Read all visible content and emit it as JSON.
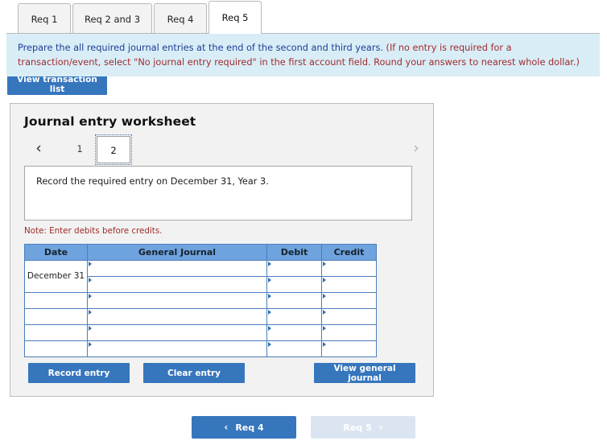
{
  "tabs": [
    {
      "label": "Req 1",
      "active": false
    },
    {
      "label": "Req 2 and 3",
      "active": false
    },
    {
      "label": "Req 4",
      "active": false
    },
    {
      "label": "Req 5",
      "active": true
    }
  ],
  "instruction": {
    "lead": "Prepare the all required journal entries at the end of the second and third years.",
    "paren": "(If no entry is required for a transaction/event, select \"No journal entry required\" in the first account field. Round your answers to nearest whole dollar.)"
  },
  "toolbar": {
    "view_transaction_list": "View transaction list"
  },
  "worksheet": {
    "title": "Journal entry worksheet",
    "pager": {
      "prev_icon": "‹",
      "next_icon": "›",
      "pages": [
        "1",
        "2"
      ],
      "selected": "2"
    },
    "prompt": "Record the required entry on December 31, Year 3.",
    "note": "Note: Enter debits before credits.",
    "table": {
      "columns": [
        "Date",
        "General Journal",
        "Debit",
        "Credit"
      ],
      "rows": [
        {
          "date": "December 31",
          "general_journal": "",
          "debit": "",
          "credit": ""
        },
        {
          "date": "",
          "general_journal": "",
          "debit": "",
          "credit": ""
        },
        {
          "date": "",
          "general_journal": "",
          "debit": "",
          "credit": ""
        },
        {
          "date": "",
          "general_journal": "",
          "debit": "",
          "credit": ""
        },
        {
          "date": "",
          "general_journal": "",
          "debit": "",
          "credit": ""
        },
        {
          "date": "",
          "general_journal": "",
          "debit": "",
          "credit": ""
        }
      ]
    },
    "actions": {
      "record_entry": "Record entry",
      "clear_entry": "Clear entry",
      "view_general_journal": "View general journal"
    }
  },
  "bottom_nav": {
    "prev": {
      "label": "Req 4",
      "icon": "‹",
      "disabled": false
    },
    "next": {
      "label": "Req 5",
      "icon": "›",
      "disabled": true
    }
  },
  "colors": {
    "accent": "#3676bd",
    "banner_bg": "#d9edf7",
    "table_header": "#6fa3dd",
    "note_red": "#a02c2c",
    "panel_bg": "#f2f2f2"
  }
}
